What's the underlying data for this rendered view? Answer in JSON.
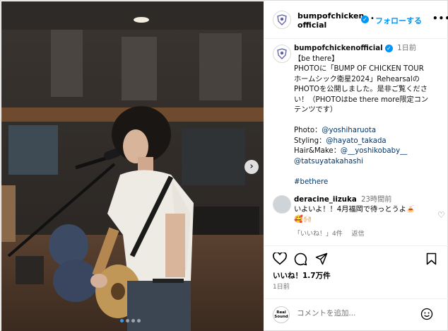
{
  "colors": {
    "accent": "#0095f6",
    "link": "#00376b",
    "muted": "#737373",
    "border": "#dbdbdb"
  },
  "photo": {
    "description_icon": "photo-carousel",
    "next_icon": "chevron-right-icon",
    "dots_count": 4,
    "active_dot": 0
  },
  "header": {
    "username_line1": "bumpofchicken",
    "username_line2": "official",
    "separator": "•",
    "follow_label": "フォローする",
    "more_label": "•••"
  },
  "caption": {
    "username": "bumpofchickenofficial",
    "time": "1日前",
    "lines": [
      "【be there】",
      "PHOTOに「BUMP OF CHICKEN TOUR",
      "ホームシック衛星2024」Rehearsalの",
      "PHOTOを公開しました。是非ご覧くださ",
      "い！（PHOTOはbe there more限定コン",
      "テンツです）"
    ],
    "credits": [
      {
        "label": "Photo：",
        "handle": "@yoshiharuota"
      },
      {
        "label": "Styling：",
        "handle": "@hayato_takada"
      },
      {
        "label": "Hair&Make：",
        "handle": "@__yoshikobaby__"
      },
      {
        "label": "",
        "handle": "@tatsuyatakahashi"
      }
    ],
    "hashtag": "#bethere"
  },
  "comment": {
    "username": "deracine_iizuka",
    "time": "23時間前",
    "text_line1": "いよいよ！！4月福岡で待っとうよ🍝",
    "text_line2": "🥰🙌🏻",
    "likes": "「いいね！」4件",
    "reply": "返信"
  },
  "actions": {
    "likes": "いいね！1.7万件",
    "date": "1日前"
  },
  "add_comment": {
    "avatar_line1": "Real",
    "avatar_line2": "Sound",
    "placeholder": "コメントを追加..."
  }
}
